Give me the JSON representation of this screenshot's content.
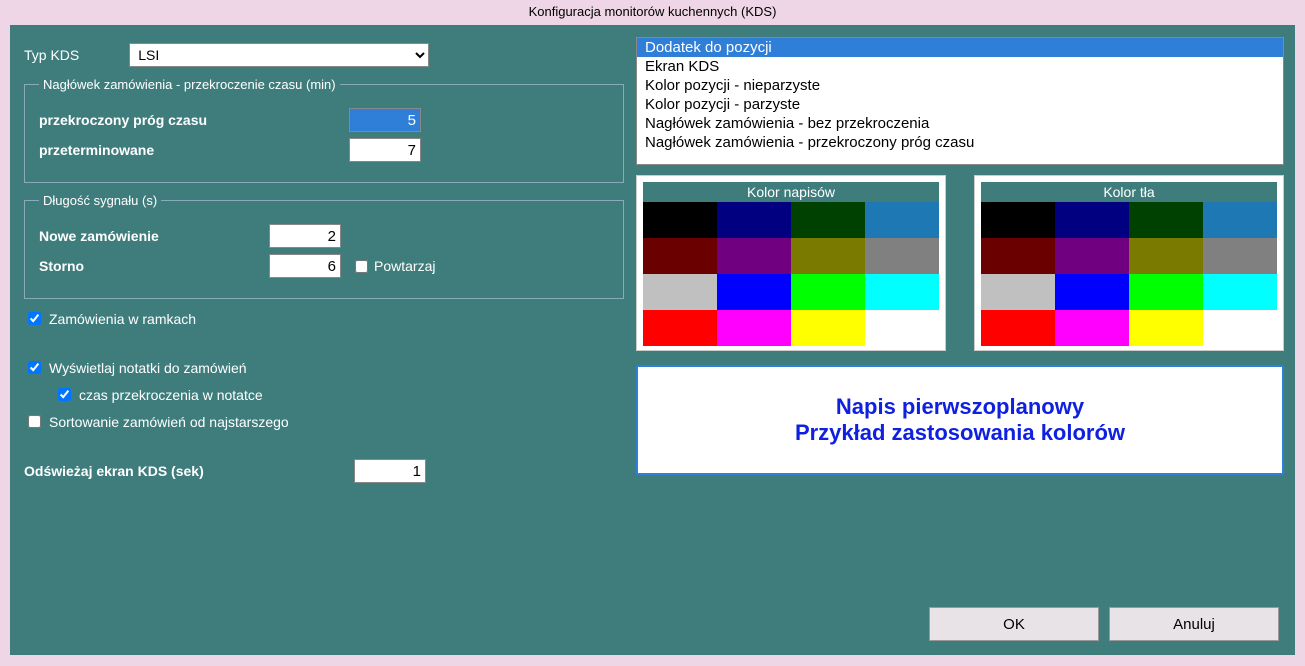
{
  "window": {
    "title": "Konfiguracja monitorów kuchennych (KDS)"
  },
  "typ_kds": {
    "label": "Typ KDS",
    "value": "LSI"
  },
  "fieldset_czas": {
    "legend": "Nagłówek zamówienia - przekroczenie czasu (min)",
    "przekroczony_label": "przekroczony próg czasu",
    "przekroczony_value": "5",
    "przeterminowane_label": "przeterminowane",
    "przeterminowane_value": "7"
  },
  "fieldset_sygnal": {
    "legend": "Długość sygnału (s)",
    "nowe_label": "Nowe zamówienie",
    "nowe_value": "2",
    "storno_label": "Storno",
    "storno_value": "6",
    "powtarzaj_label": "Powtarzaj",
    "powtarzaj_checked": false
  },
  "checkboxes": {
    "w_ramkach": {
      "label": "Zamówienia w ramkach",
      "checked": true
    },
    "notatki": {
      "label": "Wyświetlaj notatki do zamówień",
      "checked": true
    },
    "czas_notatka": {
      "label": "czas przekroczenia w notatce",
      "checked": true
    },
    "sortowanie": {
      "label": "Sortowanie zamówień od najstarszego",
      "checked": false
    }
  },
  "refresh": {
    "label": "Odświeżaj ekran KDS (sek)",
    "value": "1"
  },
  "listbox": {
    "items": [
      "Dodatek do pozycji",
      "Ekran KDS",
      "Kolor pozycji - nieparzyste",
      "Kolor pozycji - parzyste",
      "Nagłówek zamówienia - bez przekroczenia",
      "Nagłówek zamówienia - przekroczony próg czasu"
    ],
    "selected_index": 0
  },
  "palette": {
    "napisow_header": "Kolor napisów",
    "tla_header": "Kolor tła",
    "colors": [
      "#000000",
      "#000080",
      "#004000",
      "#1e78b4",
      "#6a0000",
      "#700080",
      "#7a7a00",
      "#808080",
      "#c0c0c0",
      "#0000ff",
      "#00ff00",
      "#00ffff",
      "#ff0000",
      "#ff00ff",
      "#ffff00",
      "#ffffff"
    ]
  },
  "preview": {
    "line1": "Napis pierwszoplanowy",
    "line2": "Przykład zastosowania kolorów"
  },
  "buttons": {
    "ok": "OK",
    "cancel": "Anuluj"
  }
}
